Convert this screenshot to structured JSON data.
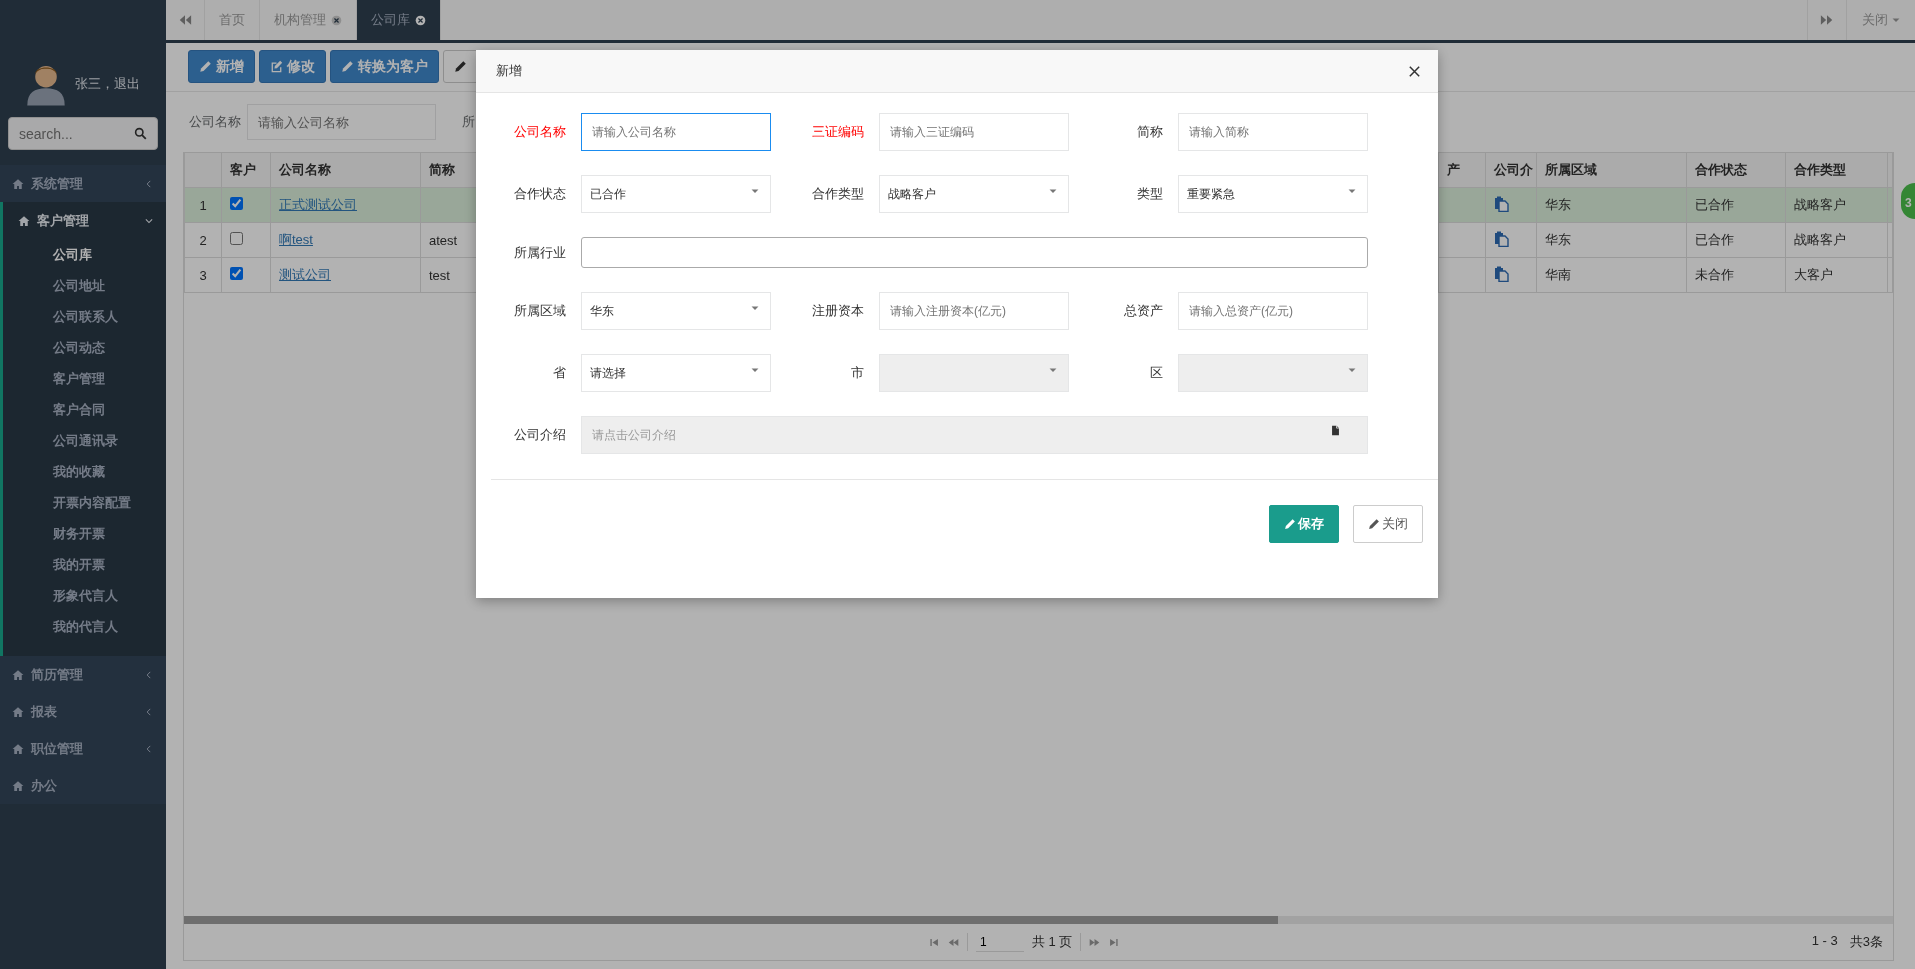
{
  "sidebar": {
    "user": "张三，退出",
    "search": {
      "placeholder": "search..."
    },
    "menu": [
      {
        "label": "系统管理",
        "kind": "group",
        "expanded": false
      },
      {
        "label": "客户管理",
        "kind": "group",
        "expanded": true,
        "children": [
          {
            "label": "公司库",
            "selected": true
          },
          {
            "label": "公司地址",
            "selected": false
          },
          {
            "label": "公司联系人",
            "selected": false
          },
          {
            "label": "公司动态",
            "selected": false
          },
          {
            "label": "客户管理",
            "selected": false
          },
          {
            "label": "客户合同",
            "selected": false
          },
          {
            "label": "公司通讯录",
            "selected": false
          },
          {
            "label": "我的收藏",
            "selected": false
          },
          {
            "label": "开票内容配置",
            "selected": false
          },
          {
            "label": "财务开票",
            "selected": false
          },
          {
            "label": "我的开票",
            "selected": false
          },
          {
            "label": "形象代言人",
            "selected": false
          },
          {
            "label": "我的代言人",
            "selected": false
          }
        ]
      },
      {
        "label": "简历管理",
        "kind": "group",
        "expanded": false
      },
      {
        "label": "报表",
        "kind": "group",
        "expanded": false
      },
      {
        "label": "职位管理",
        "kind": "group",
        "expanded": false
      },
      {
        "label": "办公",
        "kind": "link"
      }
    ]
  },
  "tabs": {
    "items": [
      {
        "label": "首页",
        "closable": false,
        "selected": false
      },
      {
        "label": "机构管理",
        "closable": true,
        "selected": false
      },
      {
        "label": "公司库",
        "closable": true,
        "selected": true
      }
    ],
    "close_menu": "关闭"
  },
  "toolbar": {
    "buttons": [
      {
        "label": "新增",
        "kind": "pencil"
      },
      {
        "label": "修改",
        "kind": "edit"
      },
      {
        "label": "转换为客户",
        "kind": "pencil"
      },
      {
        "kind": "pencil"
      }
    ]
  },
  "filters": [
    {
      "label": "公司名称",
      "placeholder": "请输入公司名称"
    },
    {
      "label": "所"
    }
  ],
  "table": {
    "columns": [
      {
        "label": "客户",
        "kind": "check"
      },
      {
        "label": "公司名称",
        "kind": "link"
      },
      {
        "label": "简称",
        "kind": "text"
      },
      {
        "kind": "covered"
      },
      {
        "label": "产",
        "kind": "text"
      },
      {
        "label": "公司介",
        "kind": "icon"
      },
      {
        "label": "所属区域",
        "kind": "text"
      },
      {
        "label": "合作状态",
        "kind": "text"
      },
      {
        "label": "合作类型",
        "kind": "text"
      }
    ],
    "rows": [
      {
        "number": "1",
        "selected": true,
        "customer": true,
        "name": "正式测试公司",
        "region": "华东",
        "status": "已合作",
        "type": "战略客户"
      },
      {
        "number": "2",
        "selected": false,
        "customer": false,
        "name": "啊test",
        "short": "atest",
        "region": "华东",
        "status": "已合作",
        "type": "战略客户"
      },
      {
        "number": "3",
        "selected": false,
        "customer": true,
        "name": "测试公司",
        "short": "test",
        "region": "华南",
        "status": "未合作",
        "type": "大客户"
      }
    ]
  },
  "pagination": {
    "page": "1",
    "pages": "共 1 页",
    "range": "1 - 3",
    "total": "共3条"
  },
  "badge": "3",
  "modal": {
    "title": "新增",
    "fields": [
      {
        "label": "公司名称",
        "kind": "input",
        "required": true,
        "focused": true,
        "placeholder": "请输入公司名称"
      },
      {
        "label": "三证编码",
        "kind": "input",
        "required": true,
        "focused": false,
        "placeholder": "请输入三证编码"
      },
      {
        "label": "简称",
        "kind": "input",
        "required": false,
        "focused": false,
        "placeholder": "请输入简称"
      },
      {
        "label": "合作状态",
        "kind": "select",
        "required": false,
        "disabled": false,
        "value": "已合作"
      },
      {
        "label": "合作类型",
        "kind": "select",
        "required": false,
        "disabled": false,
        "value": "战略客户"
      },
      {
        "label": "类型",
        "kind": "select",
        "required": false,
        "disabled": false,
        "value": "重要紧急"
      },
      {
        "label": "所属行业",
        "kind": "input",
        "required": false,
        "focused": false,
        "wide": true
      },
      {
        "label": "所属区域",
        "kind": "select",
        "required": false,
        "disabled": false,
        "value": "华东"
      },
      {
        "label": "注册资本",
        "kind": "input",
        "required": false,
        "focused": false,
        "placeholder": "请输入注册资本(亿元)"
      },
      {
        "label": "总资产",
        "kind": "input",
        "required": false,
        "focused": false,
        "placeholder": "请输入总资产(亿元)"
      },
      {
        "label": "省",
        "kind": "select",
        "required": false,
        "disabled": false,
        "value": "请选择"
      },
      {
        "label": "市",
        "kind": "select",
        "required": false,
        "disabled": true
      },
      {
        "label": "区",
        "kind": "select",
        "required": false,
        "disabled": true
      },
      {
        "label": "公司介绍",
        "kind": "picker",
        "required": false,
        "wide": true,
        "placeholder": "请点击公司介绍"
      }
    ],
    "buttons": [
      {
        "label": "保存",
        "kind": "primary"
      },
      {
        "label": "关闭",
        "kind": "default"
      }
    ]
  }
}
